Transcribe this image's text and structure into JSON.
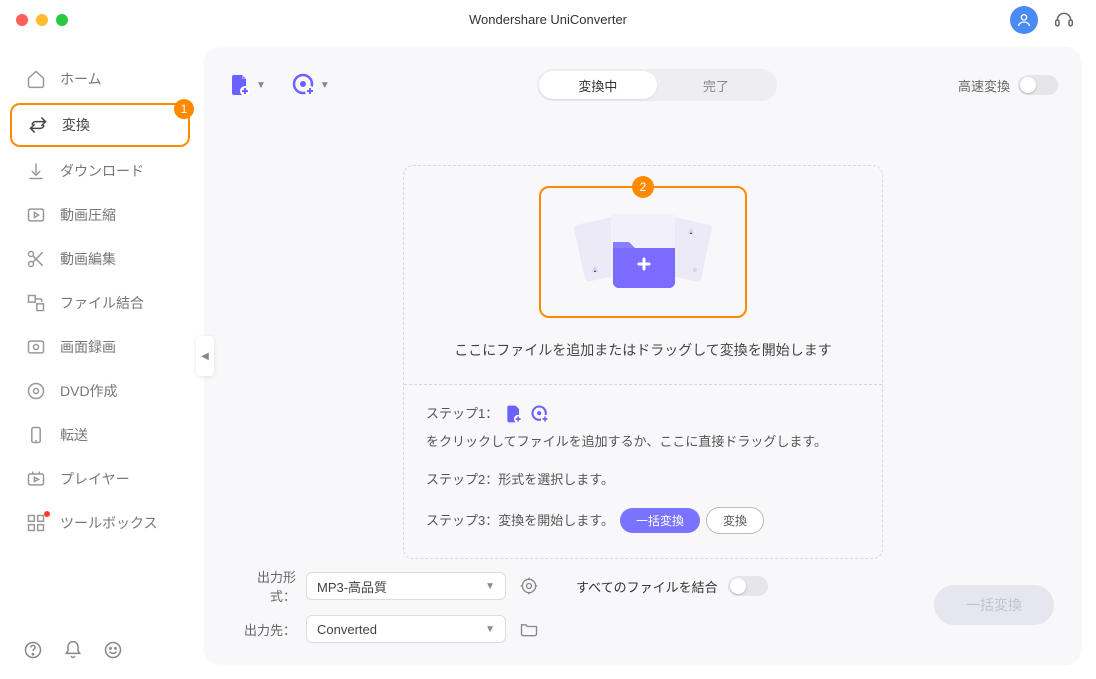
{
  "app_title": "Wondershare UniConverter",
  "sidebar": {
    "items": [
      {
        "label": "ホーム"
      },
      {
        "label": "変換",
        "badge": "1"
      },
      {
        "label": "ダウンロード"
      },
      {
        "label": "動画圧縮"
      },
      {
        "label": "動画編集"
      },
      {
        "label": "ファイル結合"
      },
      {
        "label": "画面録画"
      },
      {
        "label": "DVD作成"
      },
      {
        "label": "転送"
      },
      {
        "label": "プレイヤー"
      },
      {
        "label": "ツールボックス"
      }
    ]
  },
  "tabs": {
    "inprogress": "変換中",
    "done": "完了"
  },
  "speed_label": "高速変換",
  "drop": {
    "badge": "2",
    "text": "ここにファイルを追加またはドラッグして変換を開始します"
  },
  "steps": {
    "s1_a": "ステップ1：",
    "s1_b": "をクリックしてファイルを追加するか、ここに直接ドラッグします。",
    "s2": "ステップ2：形式を選択します。",
    "s3": "ステップ3：変換を開始します。",
    "batch_btn": "一括変換",
    "convert_btn": "変換"
  },
  "bottom": {
    "format_label": "出力形式：",
    "format_value": "MP3-高品質",
    "dest_label": "出力先：",
    "dest_value": "Converted",
    "merge_label": "すべてのファイルを結合",
    "batch_btn": "一括変換"
  }
}
